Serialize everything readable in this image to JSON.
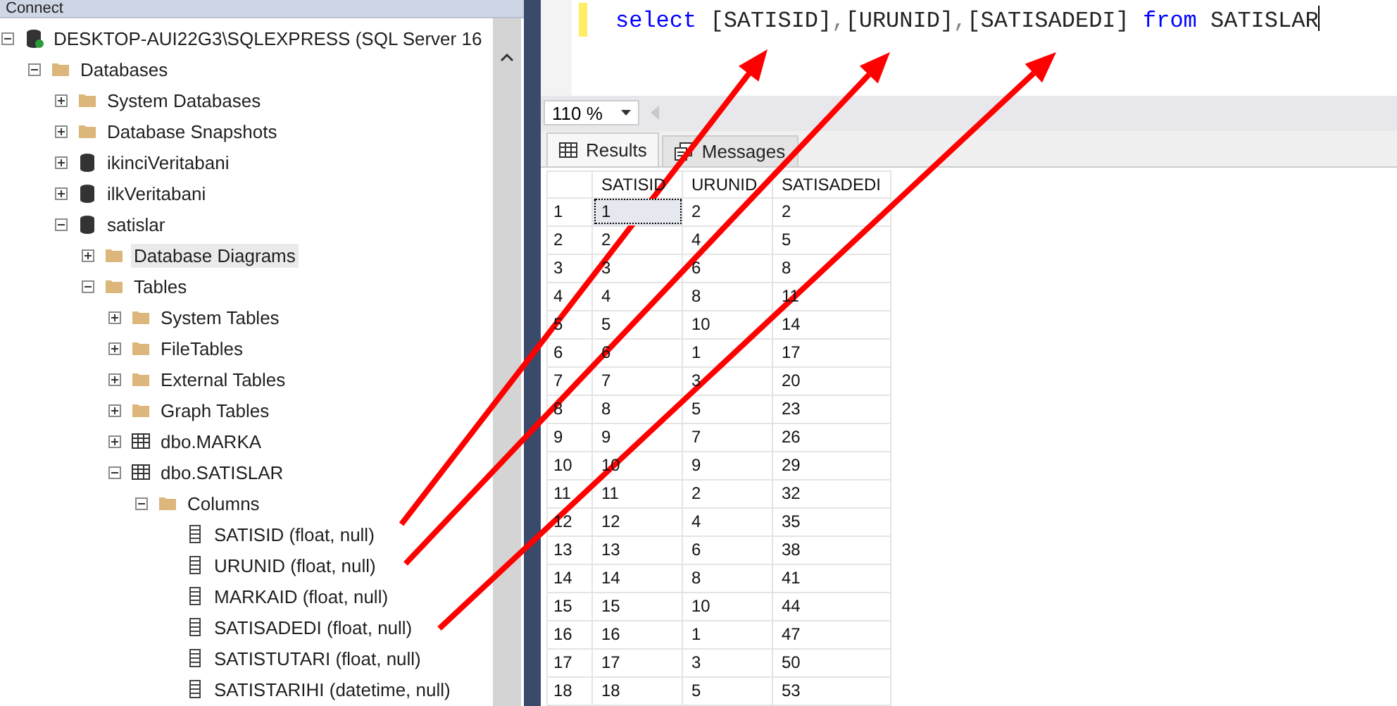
{
  "toolbar": {
    "label": "Connect"
  },
  "object_explorer": {
    "tree": [
      {
        "label": "DESKTOP-AUI22G3\\SQLEXPRESS (SQL Server 16",
        "kind": "server",
        "expanded": true,
        "selected": false,
        "children": [
          {
            "label": "Databases",
            "kind": "folder",
            "expanded": true,
            "selected": false,
            "children": [
              {
                "label": "System Databases",
                "kind": "folder",
                "expanded": false,
                "selected": false
              },
              {
                "label": "Database Snapshots",
                "kind": "folder",
                "expanded": false,
                "selected": false
              },
              {
                "label": "ikinciVeritabani",
                "kind": "database",
                "expanded": false,
                "selected": false
              },
              {
                "label": "ilkVeritabani",
                "kind": "database",
                "expanded": false,
                "selected": false
              },
              {
                "label": "satislar",
                "kind": "database",
                "expanded": true,
                "selected": false,
                "children": [
                  {
                    "label": "Database Diagrams",
                    "kind": "folder",
                    "expanded": false,
                    "selected": true
                  },
                  {
                    "label": "Tables",
                    "kind": "folder",
                    "expanded": true,
                    "selected": false,
                    "children": [
                      {
                        "label": "System Tables",
                        "kind": "folder",
                        "expanded": false,
                        "selected": false
                      },
                      {
                        "label": "FileTables",
                        "kind": "folder",
                        "expanded": false,
                        "selected": false
                      },
                      {
                        "label": "External Tables",
                        "kind": "folder",
                        "expanded": false,
                        "selected": false
                      },
                      {
                        "label": "Graph Tables",
                        "kind": "folder",
                        "expanded": false,
                        "selected": false
                      },
                      {
                        "label": "dbo.MARKA",
                        "kind": "table",
                        "expanded": false,
                        "selected": false
                      },
                      {
                        "label": "dbo.SATISLAR",
                        "kind": "table",
                        "expanded": true,
                        "selected": false,
                        "children": [
                          {
                            "label": "Columns",
                            "kind": "folder",
                            "expanded": true,
                            "selected": false,
                            "children": [
                              {
                                "label": "SATISID (float, null)",
                                "kind": "column",
                                "selected": false
                              },
                              {
                                "label": "URUNID (float, null)",
                                "kind": "column",
                                "selected": false
                              },
                              {
                                "label": "MARKAID (float, null)",
                                "kind": "column",
                                "selected": false
                              },
                              {
                                "label": "SATISADEDI (float, null)",
                                "kind": "column",
                                "selected": false
                              },
                              {
                                "label": "SATISTUTARI (float, null)",
                                "kind": "column",
                                "selected": false
                              },
                              {
                                "label": "SATISTARIHI (datetime, null)",
                                "kind": "column",
                                "selected": false
                              }
                            ]
                          }
                        ]
                      }
                    ]
                  }
                ]
              }
            ]
          }
        ]
      }
    ]
  },
  "editor": {
    "tokens": [
      {
        "text": "select",
        "kind": "keyword"
      },
      {
        "text": " [SATISID]",
        "kind": "text"
      },
      {
        "text": ",",
        "kind": "punct"
      },
      {
        "text": "[URUNID]",
        "kind": "text"
      },
      {
        "text": ",",
        "kind": "punct"
      },
      {
        "text": "[SATISADEDI] ",
        "kind": "text"
      },
      {
        "text": "from",
        "kind": "keyword"
      },
      {
        "text": " SATISLAR",
        "kind": "text"
      }
    ]
  },
  "zoom": {
    "value": "110 %"
  },
  "tabs": [
    {
      "label": "Results",
      "selected": true
    },
    {
      "label": "Messages",
      "selected": false
    }
  ],
  "results": {
    "columns": [
      "SATISID",
      "URUNID",
      "SATISADEDI"
    ],
    "rows": [
      {
        "number": "1",
        "cells": [
          "1",
          "2",
          "2"
        ],
        "selected": true
      },
      {
        "number": "2",
        "cells": [
          "2",
          "4",
          "5"
        ],
        "selected": false
      },
      {
        "number": "3",
        "cells": [
          "3",
          "6",
          "8"
        ],
        "selected": false
      },
      {
        "number": "4",
        "cells": [
          "4",
          "8",
          "11"
        ],
        "selected": false
      },
      {
        "number": "5",
        "cells": [
          "5",
          "10",
          "14"
        ],
        "selected": false
      },
      {
        "number": "6",
        "cells": [
          "6",
          "1",
          "17"
        ],
        "selected": false
      },
      {
        "number": "7",
        "cells": [
          "7",
          "3",
          "20"
        ],
        "selected": false
      },
      {
        "number": "8",
        "cells": [
          "8",
          "5",
          "23"
        ],
        "selected": false
      },
      {
        "number": "9",
        "cells": [
          "9",
          "7",
          "26"
        ],
        "selected": false
      },
      {
        "number": "10",
        "cells": [
          "10",
          "9",
          "29"
        ],
        "selected": false
      },
      {
        "number": "11",
        "cells": [
          "11",
          "2",
          "32"
        ],
        "selected": false
      },
      {
        "number": "12",
        "cells": [
          "12",
          "4",
          "35"
        ],
        "selected": false
      },
      {
        "number": "13",
        "cells": [
          "13",
          "6",
          "38"
        ],
        "selected": false
      },
      {
        "number": "14",
        "cells": [
          "14",
          "8",
          "41"
        ],
        "selected": false
      },
      {
        "number": "15",
        "cells": [
          "15",
          "10",
          "44"
        ],
        "selected": false
      },
      {
        "number": "16",
        "cells": [
          "16",
          "1",
          "47"
        ],
        "selected": false
      },
      {
        "number": "17",
        "cells": [
          "17",
          "3",
          "50"
        ],
        "selected": false
      },
      {
        "number": "18",
        "cells": [
          "18",
          "5",
          "53"
        ],
        "selected": false
      }
    ]
  }
}
